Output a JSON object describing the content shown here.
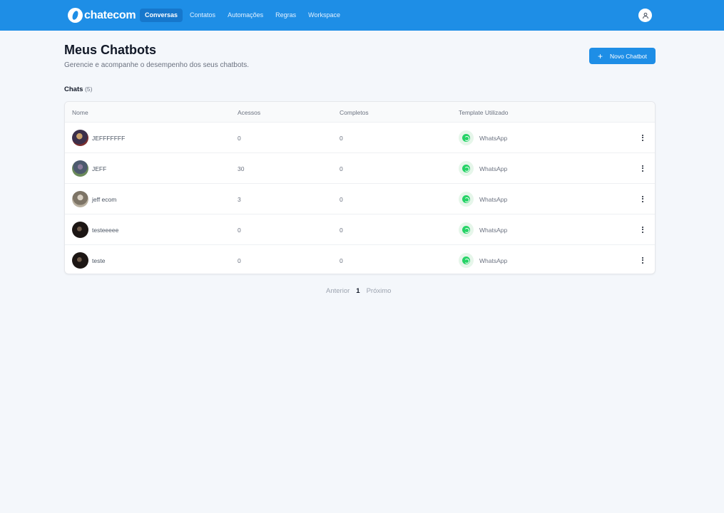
{
  "brand": {
    "name": "chatecom"
  },
  "nav": {
    "items": [
      {
        "label": "Conversas",
        "active": true
      },
      {
        "label": "Contatos",
        "active": false
      },
      {
        "label": "Automações",
        "active": false
      },
      {
        "label": "Regras",
        "active": false
      },
      {
        "label": "Workspace",
        "active": false
      }
    ]
  },
  "header": {
    "title": "Meus Chatbots",
    "subtitle": "Gerencie e acompanhe o desempenho dos seus chatbots.",
    "new_button": "Novo Chatbot"
  },
  "chats": {
    "heading": "Chats",
    "count": "(5)"
  },
  "table": {
    "columns": [
      "Nome",
      "Acessos",
      "Completos",
      "Template Utilizado"
    ],
    "rows": [
      {
        "name": "JEFFFFFFF",
        "acessos": "0",
        "completos": "0",
        "template": "WhatsApp"
      },
      {
        "name": "JEFF",
        "acessos": "30",
        "completos": "0",
        "template": "WhatsApp"
      },
      {
        "name": "jeff ecom",
        "acessos": "3",
        "completos": "0",
        "template": "WhatsApp"
      },
      {
        "name": "testeeeee",
        "acessos": "0",
        "completos": "0",
        "template": "WhatsApp"
      },
      {
        "name": "teste",
        "acessos": "0",
        "completos": "0",
        "template": "WhatsApp"
      }
    ]
  },
  "pagination": {
    "prev": "Anterior",
    "page": "1",
    "next": "Próximo"
  },
  "colors": {
    "primary": "#1e8ee6",
    "background": "#f4f7fb",
    "whatsapp": "#25d366"
  }
}
